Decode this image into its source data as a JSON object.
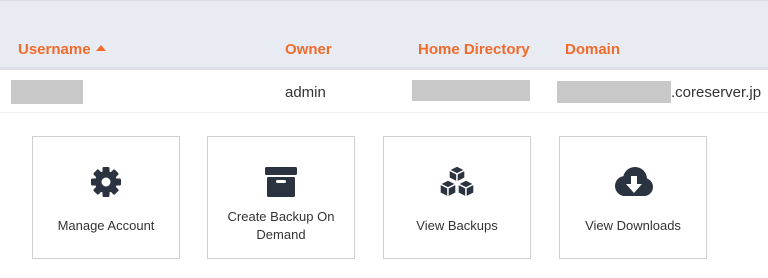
{
  "table": {
    "headers": {
      "username": "Username",
      "owner": "Owner",
      "home_directory": "Home Directory",
      "domain": "Domain"
    },
    "sort": {
      "column": "username",
      "direction": "ascending"
    },
    "rows": [
      {
        "owner": "admin",
        "domain_suffix": ".coreserver.jp"
      }
    ]
  },
  "actions": [
    {
      "label": "Manage Account",
      "icon": "gear-icon"
    },
    {
      "label": "Create Backup On Demand",
      "icon": "archive-box-icon"
    },
    {
      "label": "View Backups",
      "icon": "cubes-icon"
    },
    {
      "label": "View Downloads",
      "icon": "cloud-download-icon"
    }
  ],
  "colors": {
    "accent": "#f26b2c",
    "header_bg": "#e8ebf2",
    "icon": "#2b3340",
    "redaction": "#c8c8c8"
  }
}
